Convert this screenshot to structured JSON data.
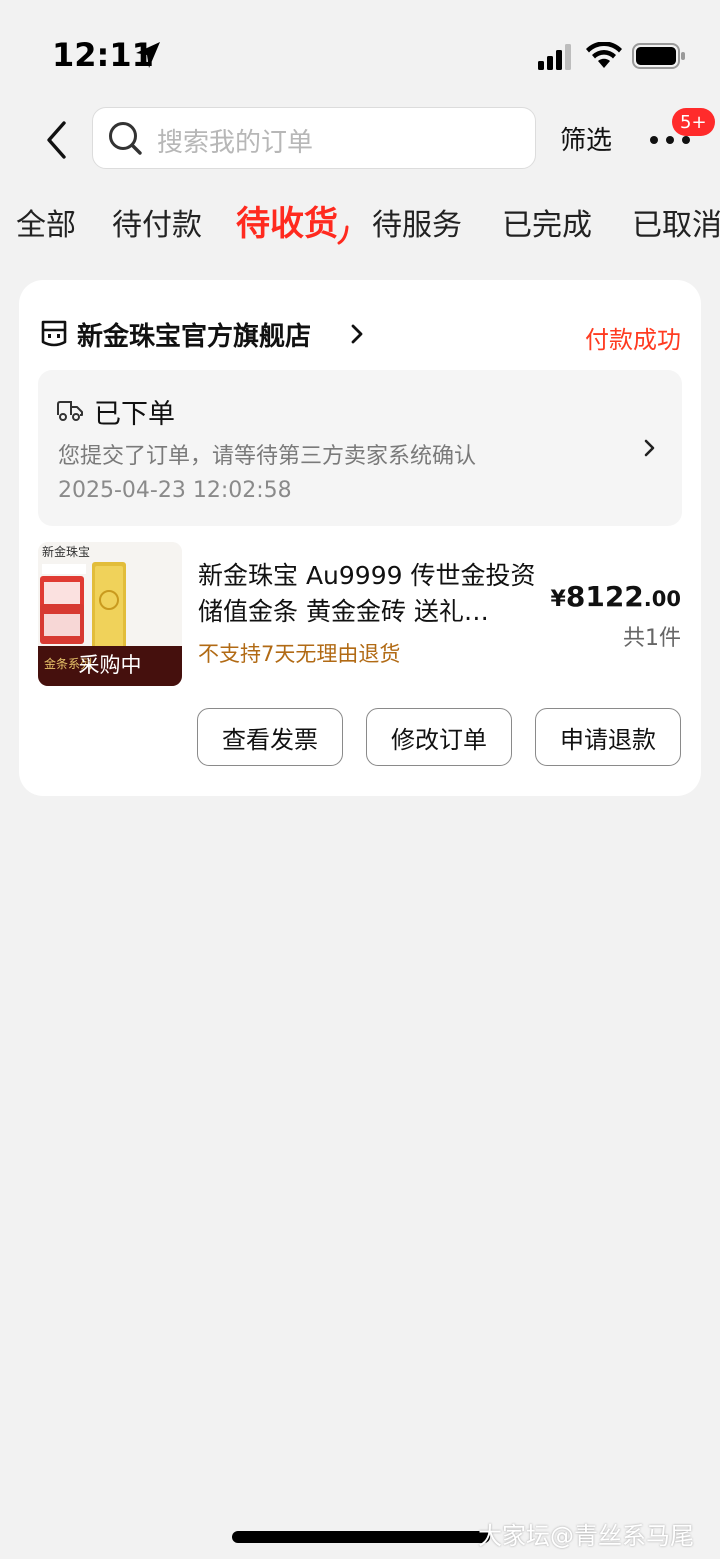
{
  "status_bar": {
    "time": "12:11"
  },
  "header": {
    "search_placeholder": "搜索我的订单",
    "filter_label": "筛选",
    "badge": "5+"
  },
  "tabs": [
    {
      "label": "全部",
      "active": false
    },
    {
      "label": "待付款",
      "active": false
    },
    {
      "label": "待收货",
      "active": true
    },
    {
      "label": "待服务",
      "active": false
    },
    {
      "label": "已完成",
      "active": false
    },
    {
      "label": "已取消",
      "active": false
    }
  ],
  "order": {
    "shop_name": "新金珠宝官方旗舰店",
    "status": "付款成功",
    "progress": {
      "title": "已下单",
      "description": "您提交了订单，请等待第三方卖家系统确认",
      "time": "2025-04-23 12:02:58"
    },
    "product": {
      "image_brand": "新金珠宝",
      "image_series": "金条系列",
      "image_overlay": "采购中",
      "title": "新金珠宝 Au9999 传世金投资储值金条 黄金金砖 送礼…",
      "return_note": "不支持7天无理由退货",
      "price_symbol": "¥",
      "price_integer": "8122",
      "price_decimal": ".00",
      "quantity": "共1件"
    },
    "buttons": {
      "invoice": "查看发票",
      "modify": "修改订单",
      "refund": "申请退款"
    }
  },
  "watermark": "大家坛@青丝系马尾",
  "colors": {
    "accent_red": "#ff2a1f",
    "return_note": "#b16a14",
    "background": "#f2f2f2"
  }
}
